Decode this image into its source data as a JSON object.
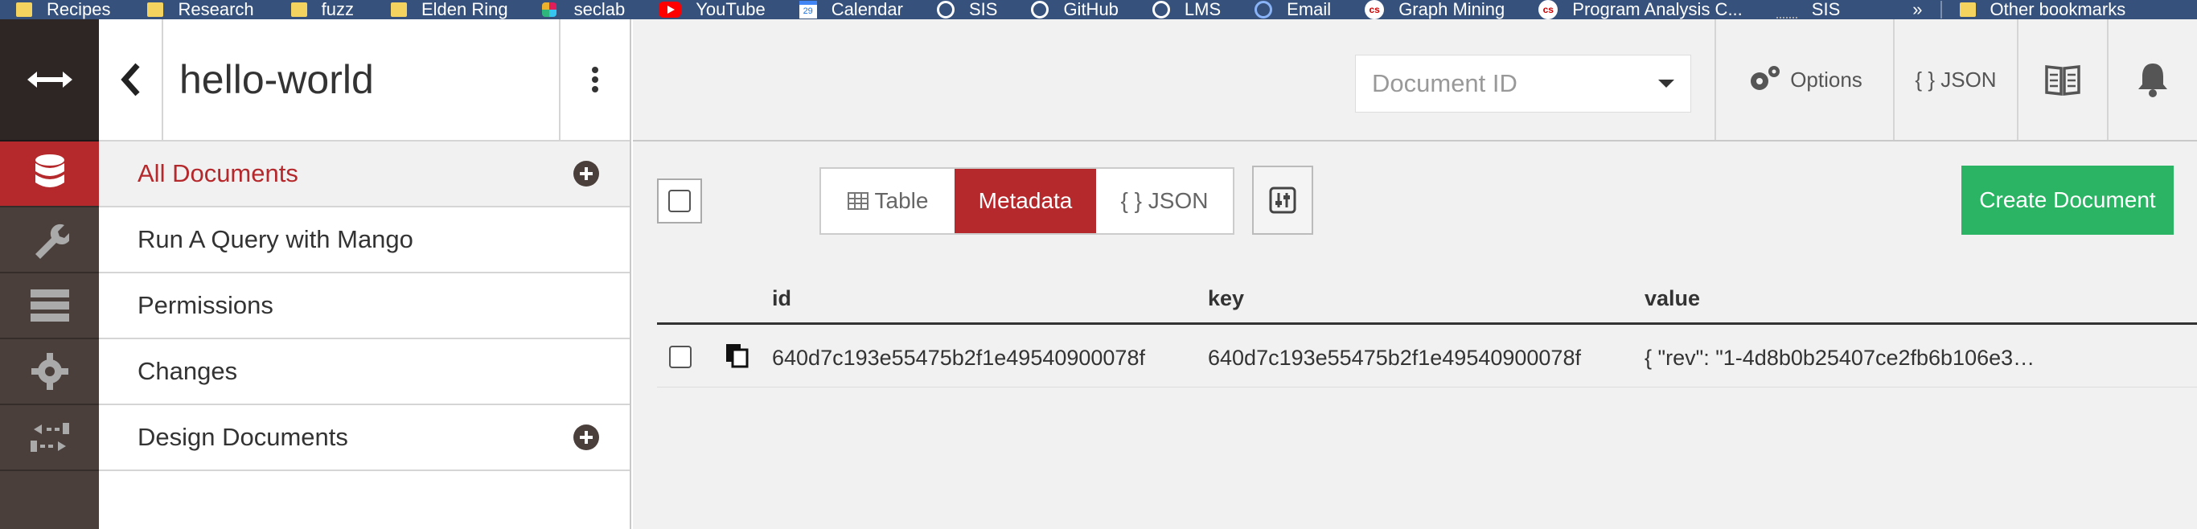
{
  "bookmarks": [
    {
      "label": "Recipes",
      "icon": "folder-icon"
    },
    {
      "label": "Research",
      "icon": "folder-icon"
    },
    {
      "label": "fuzz",
      "icon": "folder-icon"
    },
    {
      "label": "Elden Ring",
      "icon": "folder-icon"
    },
    {
      "label": "seclab",
      "icon": "slack-icon"
    },
    {
      "label": "YouTube",
      "icon": "youtube-icon"
    },
    {
      "label": "Calendar",
      "icon": "calendar-icon"
    },
    {
      "label": "SIS",
      "icon": "sis-icon"
    },
    {
      "label": "GitHub",
      "icon": "github-icon"
    },
    {
      "label": "LMS",
      "icon": "globe-icon"
    },
    {
      "label": "Email",
      "icon": "email-icon"
    },
    {
      "label": "Graph Mining",
      "icon": "cs-icon"
    },
    {
      "label": "Program Analysis C...",
      "icon": "cs-icon"
    },
    {
      "label": "SIS",
      "icon": "sis-icon"
    }
  ],
  "bookmarks_more": "»",
  "bookmarks_other": "Other bookmarks",
  "calendar_day": "29",
  "sidebar": {
    "title": "hello-world",
    "items": [
      {
        "label": "All Documents",
        "active": true,
        "plus": true
      },
      {
        "label": "Run A Query with Mango",
        "active": false,
        "plus": false
      },
      {
        "label": "Permissions",
        "active": false,
        "plus": false
      },
      {
        "label": "Changes",
        "active": false,
        "plus": false
      },
      {
        "label": "Design Documents",
        "active": false,
        "plus": true
      }
    ]
  },
  "toolbar": {
    "doc_id_placeholder": "Document ID",
    "options_label": "Options",
    "json_label": "{ } JSON"
  },
  "view_toggle": {
    "table_label": "Table",
    "metadata_label": "Metadata",
    "json_label": "{ } JSON",
    "active": "Metadata"
  },
  "create_document_label": "Create Document",
  "table": {
    "headers": [
      "id",
      "key",
      "value"
    ],
    "rows": [
      {
        "id": "640d7c193e55475b2f1e49540900078f",
        "key": "640d7c193e55475b2f1e49540900078f",
        "value": "{ \"rev\": \"1-4d8b0b25407ce2fb6b106e3…"
      }
    ]
  },
  "colors": {
    "accent": "#b5282b",
    "create": "#2ab464",
    "rail": "#4a3f3b",
    "bookmark_bar": "#35517c"
  }
}
